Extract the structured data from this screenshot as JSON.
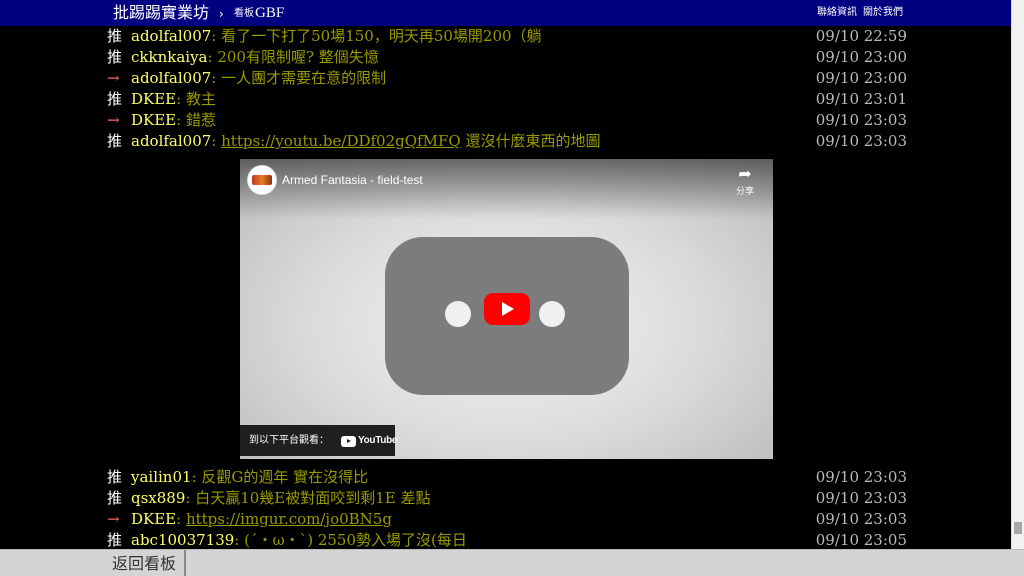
{
  "topbar": {
    "brand": "批踢踢實業坊",
    "separator": "›",
    "board_prefix": "看板",
    "board_name": "GBF",
    "links": [
      "聯絡資訊",
      "關於我們"
    ]
  },
  "pushes_top": [
    {
      "tag": "推",
      "user": "adolfal007",
      "content": ": 看了一下打了50場150，明天再50場開200（躺",
      "time": "09/10 22:59"
    },
    {
      "tag": "推",
      "user": "ckknkaiya",
      "content": ": 200有限制喔? 整個失憶",
      "time": "09/10 23:00"
    },
    {
      "tag": "→",
      "user": "adolfal007",
      "content": ": 一人團才需要在意的限制",
      "time": "09/10 23:00"
    },
    {
      "tag": "推",
      "user": "DKEE",
      "content": ": 教主",
      "time": "09/10 23:01"
    },
    {
      "tag": "→",
      "user": "DKEE",
      "content": ": 錯惹",
      "time": "09/10 23:03"
    },
    {
      "tag": "推",
      "user": "adolfal007",
      "content": ": ",
      "link": "https://youtu.be/DDf02gQfMFQ",
      "content_after": " 還沒什麼東西的地圖",
      "time": "09/10 23:03"
    }
  ],
  "video": {
    "title": "Armed Fantasia - field-test",
    "share_label": "分享",
    "watch_on_label": "到以下平台觀看：",
    "watch_on_brand": "YouTube"
  },
  "pushes_bottom": [
    {
      "tag": "推",
      "user": "yailin01",
      "content": ": 反觀G的週年 實在沒得比",
      "time": "09/10 23:03"
    },
    {
      "tag": "推",
      "user": "qsx889",
      "content": ": 白天贏10幾E被對面咬到剩1E 差點",
      "time": "09/10 23:03"
    },
    {
      "tag": "→",
      "user": "DKEE",
      "content": ": ",
      "link": "https://imgur.com/jo0BN5g",
      "content_after": "",
      "time": "09/10 23:03"
    },
    {
      "tag": "推",
      "user": "abc10037139",
      "content": ": (´・ω・`) 2550勢入場了沒(每日",
      "time": "09/10 23:05"
    }
  ],
  "bottombar": {
    "back_label": "返回看板"
  }
}
